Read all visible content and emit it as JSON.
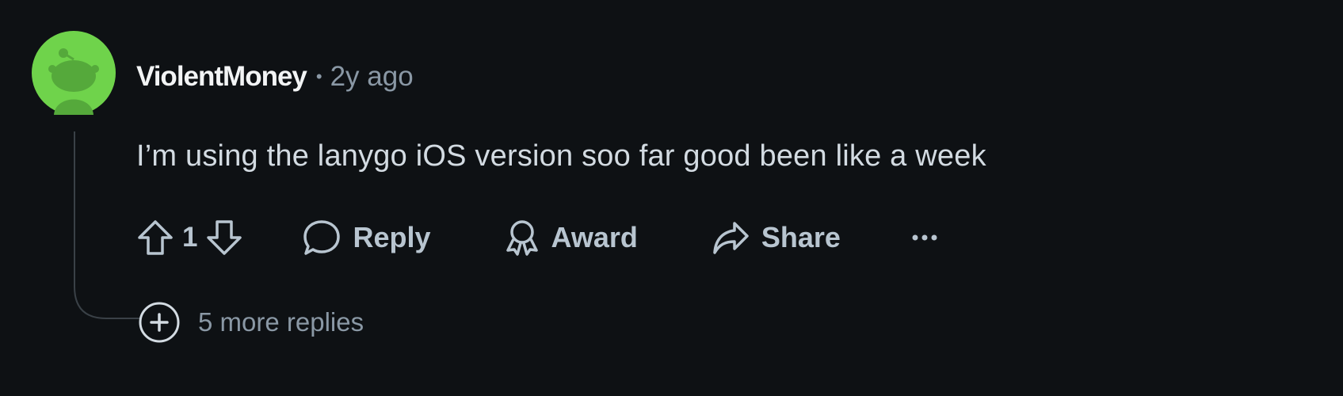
{
  "comment": {
    "username": "ViolentMoney",
    "separator": "•",
    "timestamp": "2y ago",
    "body": "I’m using the lanygo iOS version soo far good been like a week",
    "avatar_color": "#6fd34b"
  },
  "actions": {
    "upvote_icon": "arrow-up-icon",
    "vote_count": "1",
    "downvote_icon": "arrow-down-icon",
    "reply_label": "Reply",
    "reply_icon": "speech-bubble-icon",
    "award_label": "Award",
    "award_icon": "award-ribbon-icon",
    "share_label": "Share",
    "share_icon": "share-arrow-icon",
    "more_icon": "ellipsis-icon"
  },
  "replies": {
    "more_label": "5 more replies",
    "expand_icon": "plus-circle-icon"
  },
  "colors": {
    "background": "#0e1114",
    "text_primary": "#f2f4f5",
    "text_secondary": "#8a98a5",
    "text_action": "#b8c5d0"
  }
}
